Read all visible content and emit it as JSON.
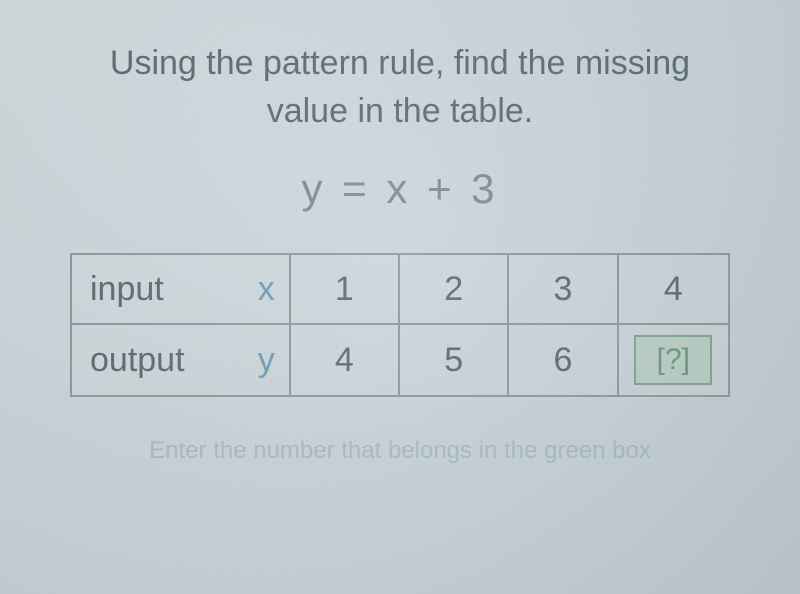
{
  "prompt": {
    "line1": "Using the pattern rule, find the missing",
    "line2": "value in the table."
  },
  "equation": "y = x + 3",
  "table": {
    "input": {
      "label": "input",
      "var": "x",
      "values": [
        "1",
        "2",
        "3",
        "4"
      ]
    },
    "output": {
      "label": "output",
      "var": "y",
      "values": [
        "4",
        "5",
        "6",
        "[?]"
      ]
    }
  },
  "hint": "Enter the number that belongs in the green box",
  "chart_data": {
    "type": "table",
    "title": "Using the pattern rule, find the missing value in the table.",
    "rule": "y = x + 3",
    "columns": [
      "x",
      "y"
    ],
    "rows": [
      {
        "x": 1,
        "y": 4
      },
      {
        "x": 2,
        "y": 5
      },
      {
        "x": 3,
        "y": 6
      },
      {
        "x": 4,
        "y": null
      }
    ],
    "missing_cell": {
      "row": 3,
      "column": "y"
    }
  }
}
